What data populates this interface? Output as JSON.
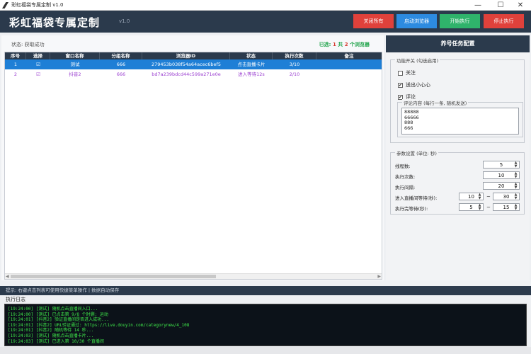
{
  "window": {
    "title": "彩虹福袋专属定制 v1.0",
    "controls": [
      "—",
      "☐",
      "✕"
    ]
  },
  "header": {
    "brand": "彩虹福袋专属定制",
    "version": "v1.0",
    "buttons": [
      {
        "label": "关闭所有",
        "color": "#e0413b"
      },
      {
        "label": "启动浏览器",
        "color": "#2d8be0"
      },
      {
        "label": "开始执行",
        "color": "#2fb36b"
      },
      {
        "label": "停止执行",
        "color": "#e0413b"
      }
    ]
  },
  "status": {
    "text": "状态: 获取成功",
    "selected_prefix": "已选: ",
    "selected_count": "1",
    "total_prefix": " 共 ",
    "total_count": "2",
    "total_suffix": " 个浏览器"
  },
  "table": {
    "columns": [
      "序号",
      "选择",
      "窗口名称",
      "分组名称",
      "浏览器ID",
      "状态",
      "执行次数",
      "备注"
    ],
    "rows": [
      {
        "index": "1",
        "checked": "☑",
        "window": "测试",
        "group": "666",
        "browser_id": "279453b038f54a64acec6bef5",
        "state": "点击直播卡片",
        "count": "3/10",
        "note": ""
      },
      {
        "index": "2",
        "checked": "☑",
        "window": "抖音2",
        "group": "666",
        "browser_id": "bd7a239bdcd44c599a271e0e",
        "state": "进入等待12s",
        "count": "2/10",
        "note": ""
      }
    ]
  },
  "right": {
    "heading": "养号任务配置",
    "features": {
      "title": "功能开关 (勾选启用)",
      "items": [
        {
          "label": "关注",
          "checked": ""
        },
        {
          "label": "送出小心心",
          "checked": "✔"
        },
        {
          "label": "评论",
          "checked": "✔"
        }
      ],
      "comment_group_title": "评论内容 (每行一条, 随机发送)",
      "comments": "88888\n66666\n888\n666"
    },
    "params": {
      "title": "参数设置 (单位: 秒)",
      "threads_label": "线程数:",
      "threads": "5",
      "runs_label": "执行次数:",
      "runs": "10",
      "interval_label": "执行间隔:",
      "interval": "20",
      "enter_wait_label": "进入直播间等待(秒):",
      "enter_wait_min": "10",
      "enter_wait_max": "30",
      "done_wait_label": "执行完等待(秒):",
      "done_wait_min": "5",
      "done_wait_max": "15",
      "range_sep": "~"
    }
  },
  "hint": "提示: 右键点击列表可使用快捷菜单操作 | 数据自动保存",
  "log": {
    "title": "执行日志",
    "lines": [
      "[19:24:00] [测试] 随机点击直播间入口...",
      "[19:24:00] [测试] 已点击第 9/8 个时删: 运动",
      "[19:24:01] [抖音2] 验证直播间是否进入成功...",
      "[19:24:01] [抖音2] URL验证通过: https://live.douyin.com/categorynew/4_108",
      "[19:24:01] [抖音2] 随机等待 14 秒...",
      "[19:24:03] [测试] 随机点击直播卡片...",
      "[19:24:03] [测试] 已进入第 10/30 个直播间"
    ]
  }
}
